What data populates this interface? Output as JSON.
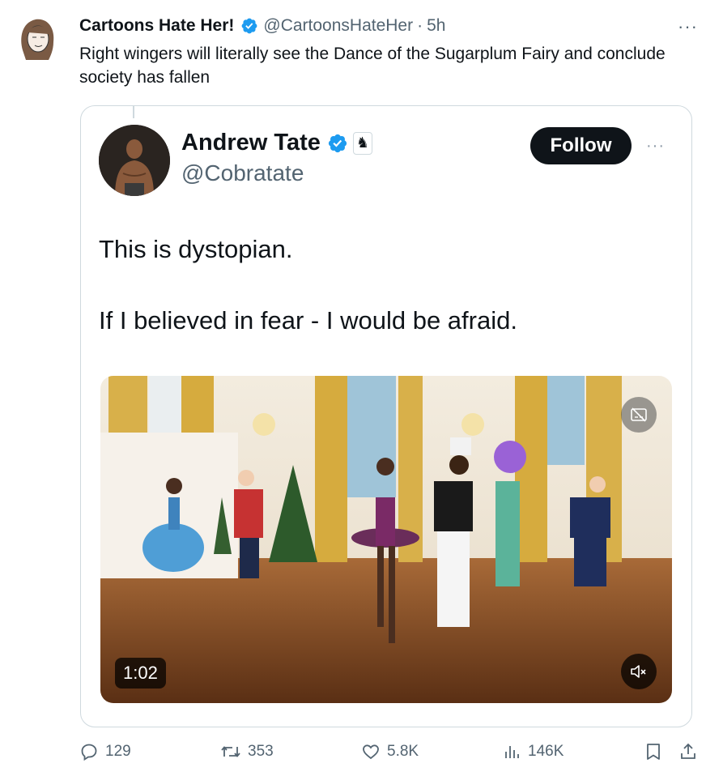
{
  "tweet": {
    "author_name": "Cartoons Hate Her!",
    "author_handle": "@CartoonsHateHer",
    "separator": "·",
    "time": "5h",
    "text": "Right wingers will literally see the Dance of the Sugarplum Fairy and conclude society has fallen",
    "more_label": "···"
  },
  "quoted": {
    "author_name": "Andrew Tate",
    "author_handle": "@Cobratate",
    "follow_label": "Follow",
    "more_label": "···",
    "line1": "This is dystopian.",
    "line2": "If I believed in fear - I would be afraid.",
    "video": {
      "duration": "1:02",
      "muted": true
    }
  },
  "actions": {
    "replies": "129",
    "reposts": "353",
    "likes": "5.8K",
    "views": "146K"
  },
  "colors": {
    "verified": "#1d9bf0",
    "text": "#0f1419",
    "secondary": "#536471",
    "border": "#cfd9de"
  },
  "icons": [
    "verified-badge-icon",
    "chess-knight-icon",
    "reply-icon",
    "repost-icon",
    "like-icon",
    "views-icon",
    "bookmark-icon",
    "share-icon",
    "mute-icon",
    "captions-icon"
  ]
}
